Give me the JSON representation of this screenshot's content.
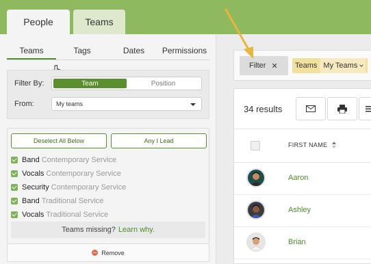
{
  "header": {
    "tabs": [
      {
        "label": "People"
      },
      {
        "label": "Teams"
      }
    ]
  },
  "left": {
    "subtabs": [
      {
        "label": "Teams"
      },
      {
        "label": "Tags"
      },
      {
        "label": "Dates"
      },
      {
        "label": "Permissions"
      }
    ],
    "filter_by_label": "Filter By:",
    "filter_options": [
      {
        "label": "Team"
      },
      {
        "label": "Position"
      }
    ],
    "from_label": "From:",
    "from_value": "My teams",
    "deselect_label": "Deselect All Below",
    "any_i_lead_label": "Any I Lead",
    "teams": [
      {
        "name": "Band",
        "service": "Contemporary Service"
      },
      {
        "name": "Vocals",
        "service": "Contemporary Service"
      },
      {
        "name": "Security",
        "service": "Contemporary Service"
      },
      {
        "name": "Band",
        "service": "Traditional Service"
      },
      {
        "name": "Vocals",
        "service": "Traditional Service"
      }
    ],
    "missing_text": "Teams missing?",
    "missing_link": "Learn why.",
    "remove_label": "Remove"
  },
  "right": {
    "filter_chip_label": "Filter",
    "filter_chip_close": "✕",
    "team_chip_key": "Teams",
    "team_chip_value": "My Teams",
    "results_count": "34 results",
    "column_first_name": "FIRST NAME",
    "people": [
      {
        "first_name": "Aaron"
      },
      {
        "first_name": "Ashley"
      },
      {
        "first_name": "Brian"
      }
    ]
  },
  "icons": {
    "mail": "mail-icon",
    "print": "print-icon",
    "more": "more-icon",
    "sort": "sort-icon"
  },
  "colors": {
    "brand_green": "#8fb95e",
    "accent_green": "#5a8f2e",
    "link_green": "#4b8b2a",
    "chip_yellow": "#f2e09d",
    "arrow_yellow": "#e8b63a"
  }
}
